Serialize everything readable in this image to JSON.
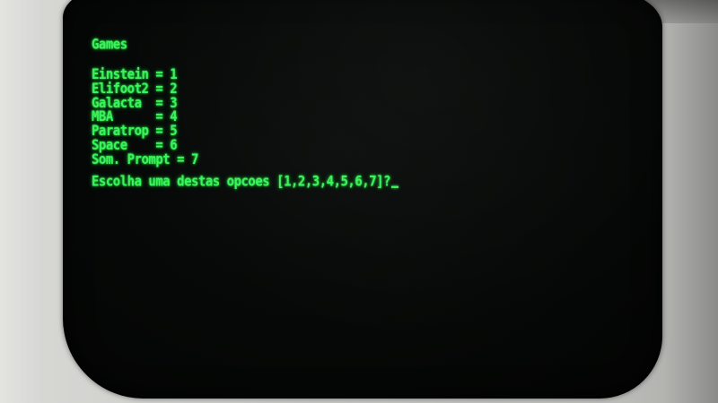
{
  "screen": {
    "title": "Games",
    "menu_items": [
      "Einstein = 1",
      "Elifoot2 = 2",
      "Galacta  = 3",
      "MBA      = 4",
      "Paratrop = 5",
      "Space    = 6",
      "Som. Prompt = 7"
    ],
    "prompt": "Escolha uma destas opcoes [1,2,3,4,5,6,7]?"
  },
  "colors": {
    "phosphor": "#3cf25a",
    "screen_bg": "#060807",
    "bezel": "#c9c9c6"
  }
}
